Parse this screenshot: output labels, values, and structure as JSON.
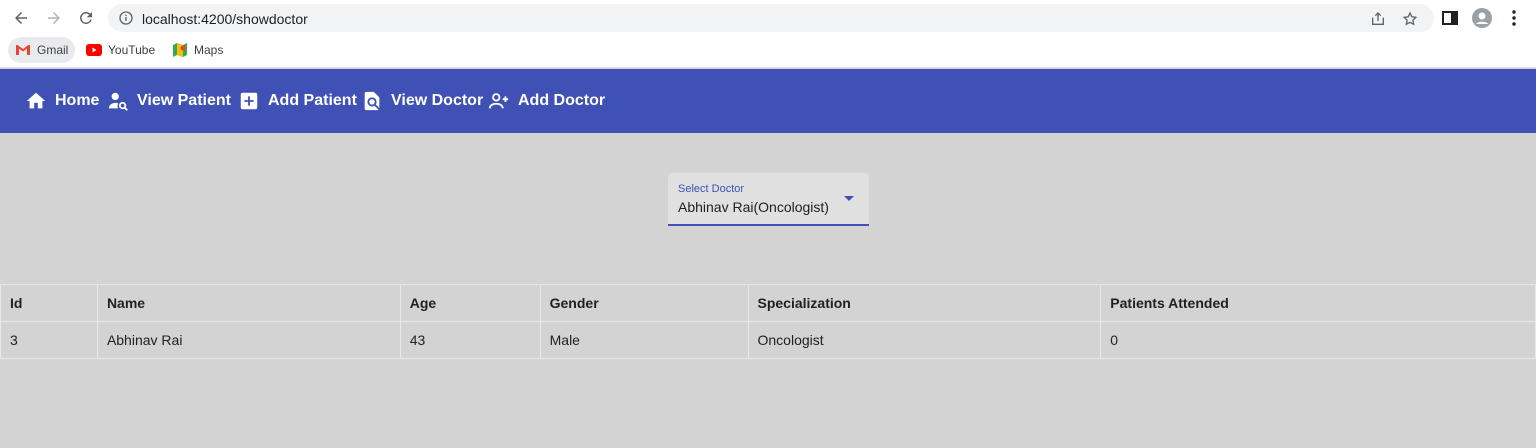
{
  "browser": {
    "url": "localhost:4200/showdoctor",
    "bookmarks": [
      {
        "label": "Gmail",
        "icon": "gmail-icon"
      },
      {
        "label": "YouTube",
        "icon": "youtube-icon"
      },
      {
        "label": "Maps",
        "icon": "maps-icon"
      }
    ]
  },
  "nav": {
    "items": [
      {
        "label": "Home",
        "icon": "home-icon"
      },
      {
        "label": "View Patient",
        "icon": "person-search-icon"
      },
      {
        "label": "Add Patient",
        "icon": "add-box-icon"
      },
      {
        "label": "View Doctor",
        "icon": "find-in-page-icon"
      },
      {
        "label": "Add Doctor",
        "icon": "person-add-icon"
      }
    ]
  },
  "select": {
    "label": "Select Doctor",
    "value": "Abhinav Rai(Oncologist)"
  },
  "table": {
    "headers": [
      "Id",
      "Name",
      "Age",
      "Gender",
      "Specialization",
      "Patients Attended"
    ],
    "rows": [
      [
        "3",
        "Abhinav Rai",
        "43",
        "Male",
        "Oncologist",
        "0"
      ]
    ]
  },
  "colors": {
    "primary": "#3f51b5",
    "background": "#d3d3d3"
  }
}
